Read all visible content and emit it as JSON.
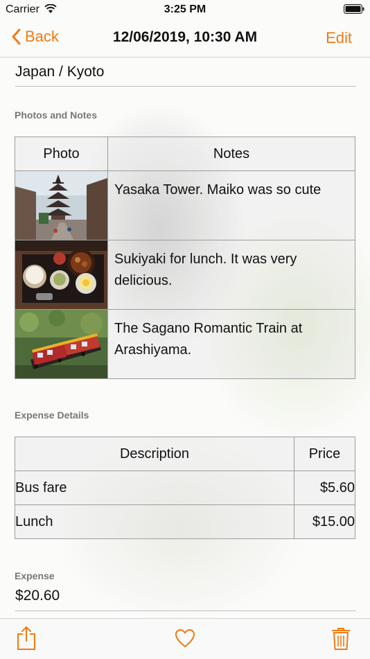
{
  "status_bar": {
    "carrier": "Carrier",
    "time": "3:25 PM"
  },
  "nav": {
    "back_label": "Back",
    "title": "12/06/2019, 10:30 AM",
    "edit_label": "Edit"
  },
  "location": "Japan / Kyoto",
  "photos_section": {
    "label": "Photos and Notes",
    "headers": [
      "Photo",
      "Notes"
    ],
    "rows": [
      {
        "photo": "yasaka-tower-photo",
        "note": "Yasaka Tower. Maiko was so cute"
      },
      {
        "photo": "sukiyaki-lunch-photo",
        "note": "Sukiyaki for lunch. It was very delicious."
      },
      {
        "photo": "sagano-train-photo",
        "note": "The Sagano Romantic Train at Arashiyama."
      }
    ]
  },
  "expenses_section": {
    "label": "Expense Details",
    "headers": [
      "Description",
      "Price"
    ],
    "rows": [
      {
        "description": "Bus fare",
        "price": "$5.60"
      },
      {
        "description": "Lunch",
        "price": "$15.00"
      }
    ]
  },
  "total": {
    "label": "Expense",
    "value": "$20.60"
  },
  "toolbar": {
    "icons": [
      "share-icon",
      "heart-icon",
      "trash-icon"
    ]
  },
  "colors": {
    "accent": "#f07a12"
  }
}
